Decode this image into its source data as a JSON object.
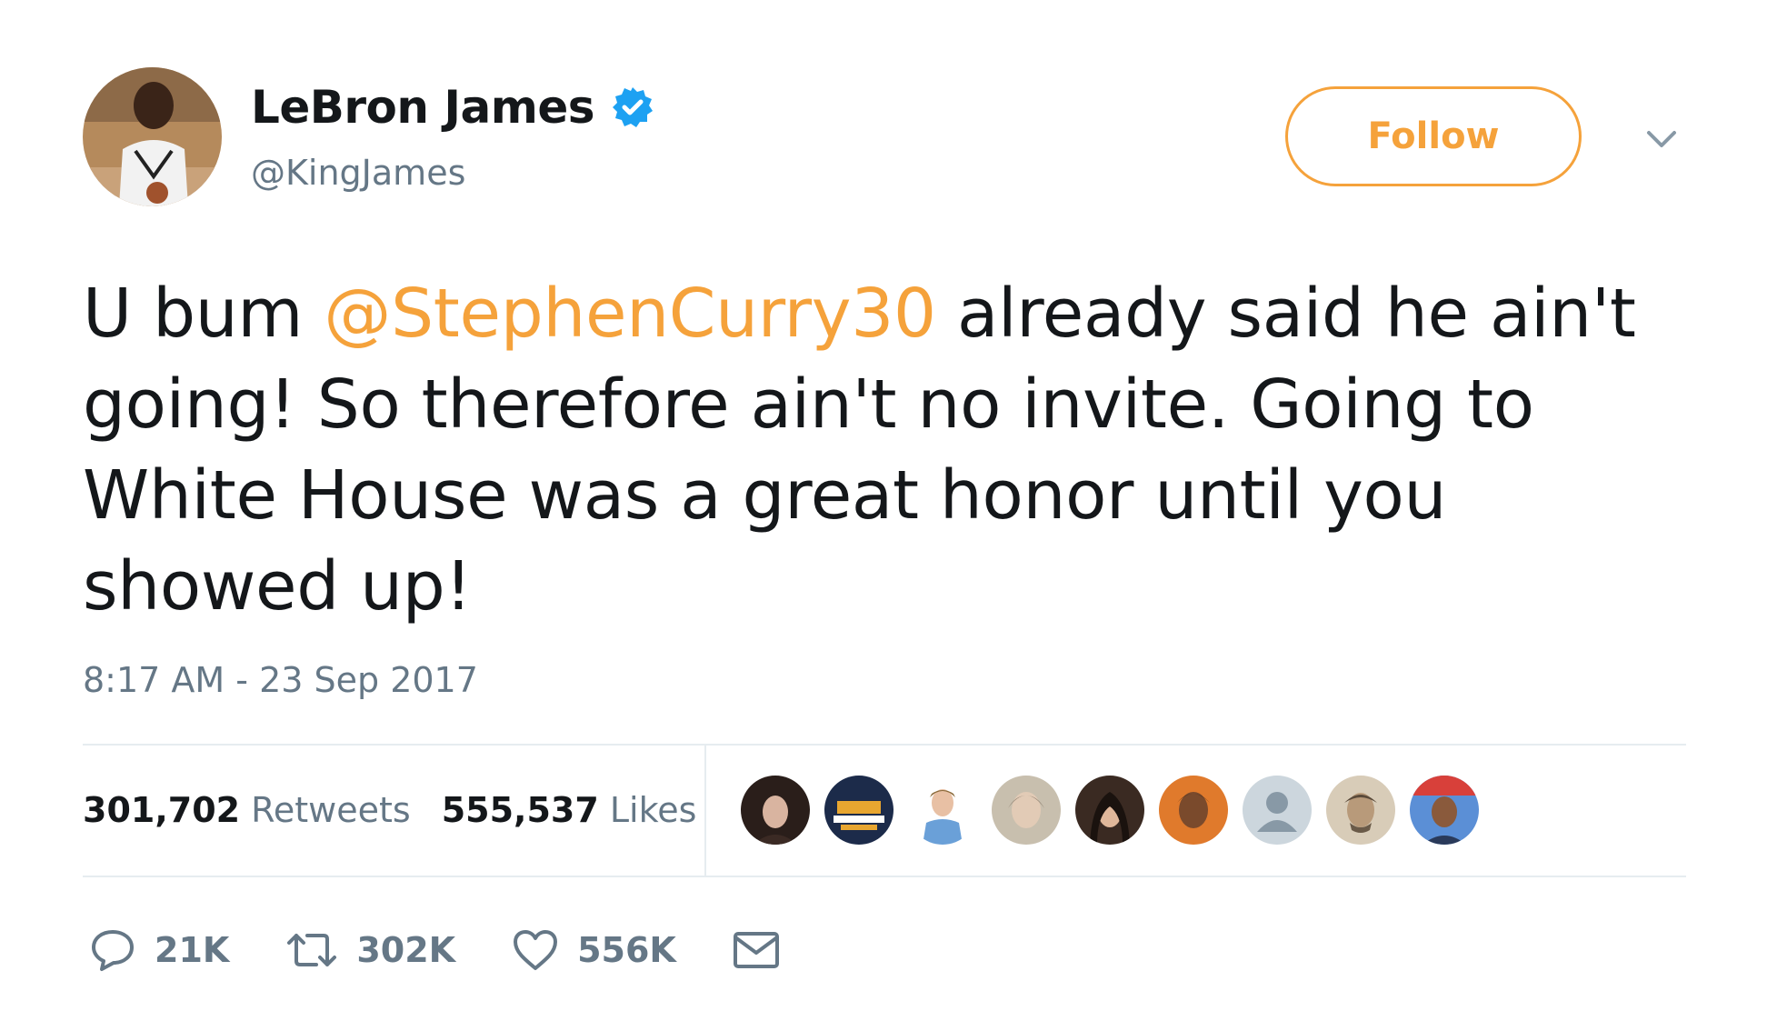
{
  "author": {
    "display_name": "LeBron James",
    "handle": "@KingJames",
    "verified": true,
    "avatar_icon": "profile-photo"
  },
  "follow_button": {
    "label": "Follow"
  },
  "menu": {
    "icon": "chevron-down-icon"
  },
  "tweet": {
    "text_before": "U bum ",
    "mention": "@StephenCurry30",
    "text_after": " already said he ain't going! So therefore ain't no invite. Going to White House was a great honor until you showed up!",
    "timestamp": "8:17 AM - 23 Sep 2017"
  },
  "stats": {
    "retweets_count": "301,702",
    "retweets_label": "Retweets",
    "likes_count": "555,537",
    "likes_label": "Likes"
  },
  "liked_by": [
    {
      "icon": "user-avatar-1"
    },
    {
      "icon": "user-avatar-2"
    },
    {
      "icon": "user-avatar-3"
    },
    {
      "icon": "user-avatar-4"
    },
    {
      "icon": "user-avatar-5"
    },
    {
      "icon": "user-avatar-6"
    },
    {
      "icon": "default-avatar-icon"
    },
    {
      "icon": "user-avatar-8"
    },
    {
      "icon": "user-avatar-9"
    }
  ],
  "actions": {
    "reply": {
      "icon": "reply-icon",
      "count": "21K"
    },
    "retweet": {
      "icon": "retweet-icon",
      "count": "302K"
    },
    "like": {
      "icon": "heart-icon",
      "count": "556K"
    },
    "message": {
      "icon": "envelope-icon"
    }
  },
  "colors": {
    "accent": "#f5a23b",
    "text": "#14171a",
    "secondary": "#657786",
    "verified": "#1da1f2",
    "divider": "#e6ecf0"
  }
}
